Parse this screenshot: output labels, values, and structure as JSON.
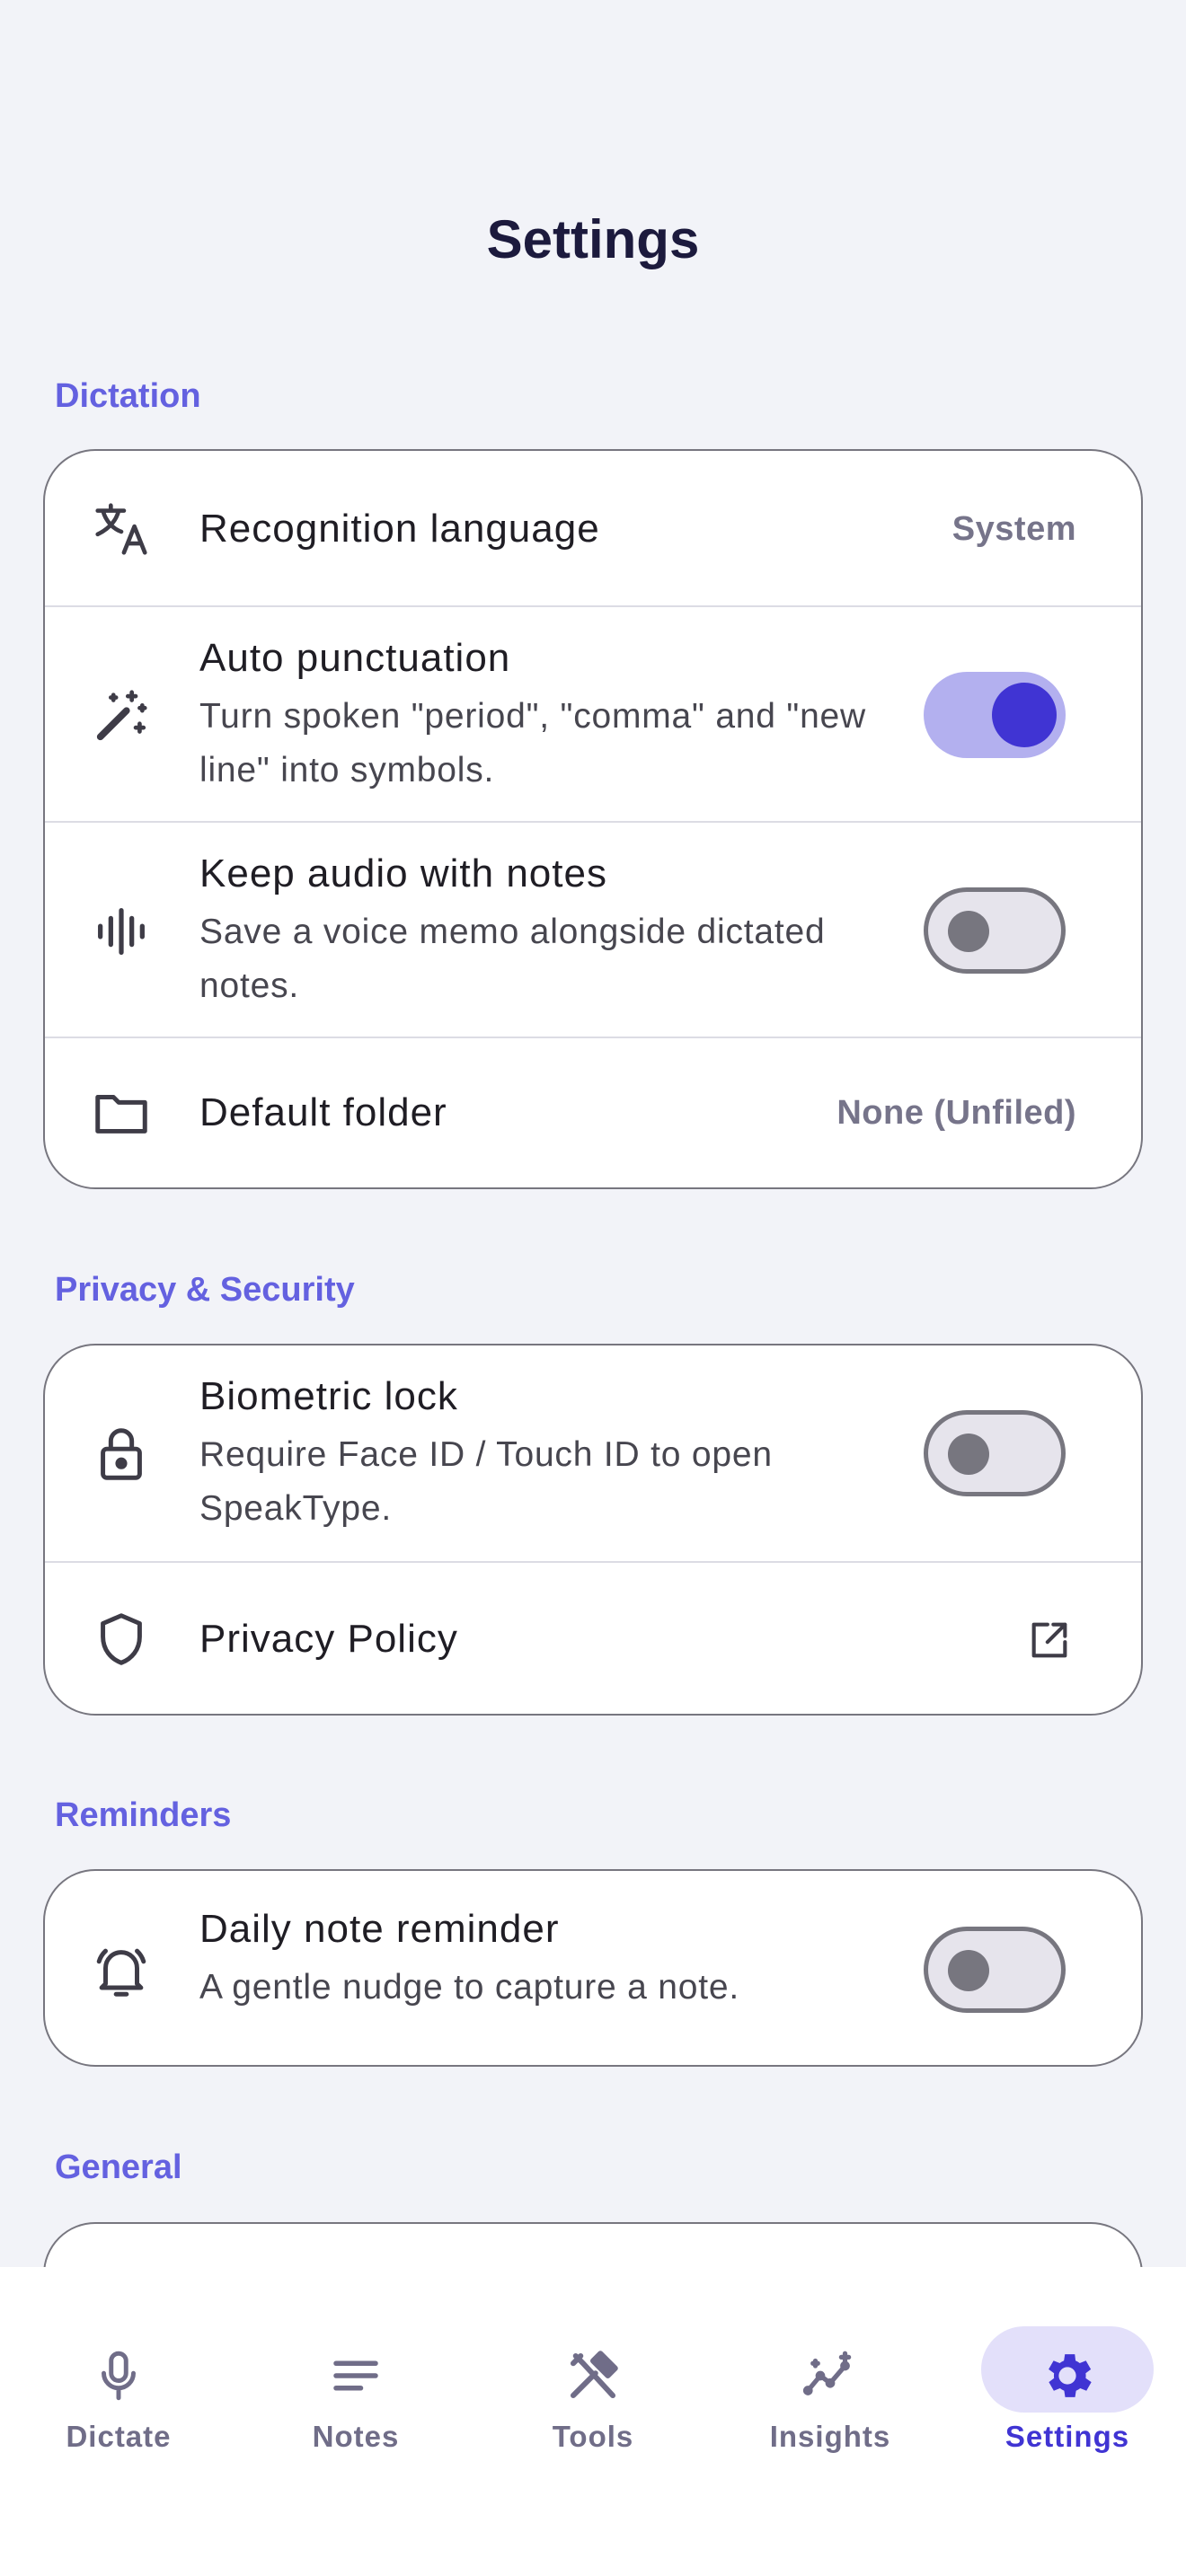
{
  "header": {
    "title": "Settings"
  },
  "sections": {
    "dictation": {
      "label": "Dictation",
      "recognition_language": {
        "title": "Recognition language",
        "value": "System"
      },
      "auto_punctuation": {
        "title": "Auto punctuation",
        "subtitle": "Turn spoken \"period\", \"comma\" and \"new line\" into symbols.",
        "enabled": true
      },
      "keep_audio": {
        "title": "Keep audio with notes",
        "subtitle": "Save a voice memo alongside dictated notes.",
        "enabled": false
      },
      "default_folder": {
        "title": "Default folder",
        "value": "None (Unfiled)"
      }
    },
    "privacy": {
      "label": "Privacy & Security",
      "biometric_lock": {
        "title": "Biometric lock",
        "subtitle": "Require Face ID / Touch ID to open SpeakType.",
        "enabled": false
      },
      "privacy_policy": {
        "title": "Privacy Policy"
      }
    },
    "reminders": {
      "label": "Reminders",
      "daily_reminder": {
        "title": "Daily note reminder",
        "subtitle": "A gentle nudge to capture a note.",
        "enabled": false
      }
    },
    "general": {
      "label": "General"
    }
  },
  "bottom_nav": {
    "items": [
      {
        "label": "Dictate",
        "icon": "microphone-icon",
        "active": false
      },
      {
        "label": "Notes",
        "icon": "notes-icon",
        "active": false
      },
      {
        "label": "Tools",
        "icon": "tools-icon",
        "active": false
      },
      {
        "label": "Insights",
        "icon": "insights-icon",
        "active": false
      },
      {
        "label": "Settings",
        "icon": "gear-icon",
        "active": true
      }
    ]
  },
  "colors": {
    "accent": "#4034d3",
    "section_label": "#6461e0",
    "background": "#f2f3f8"
  }
}
